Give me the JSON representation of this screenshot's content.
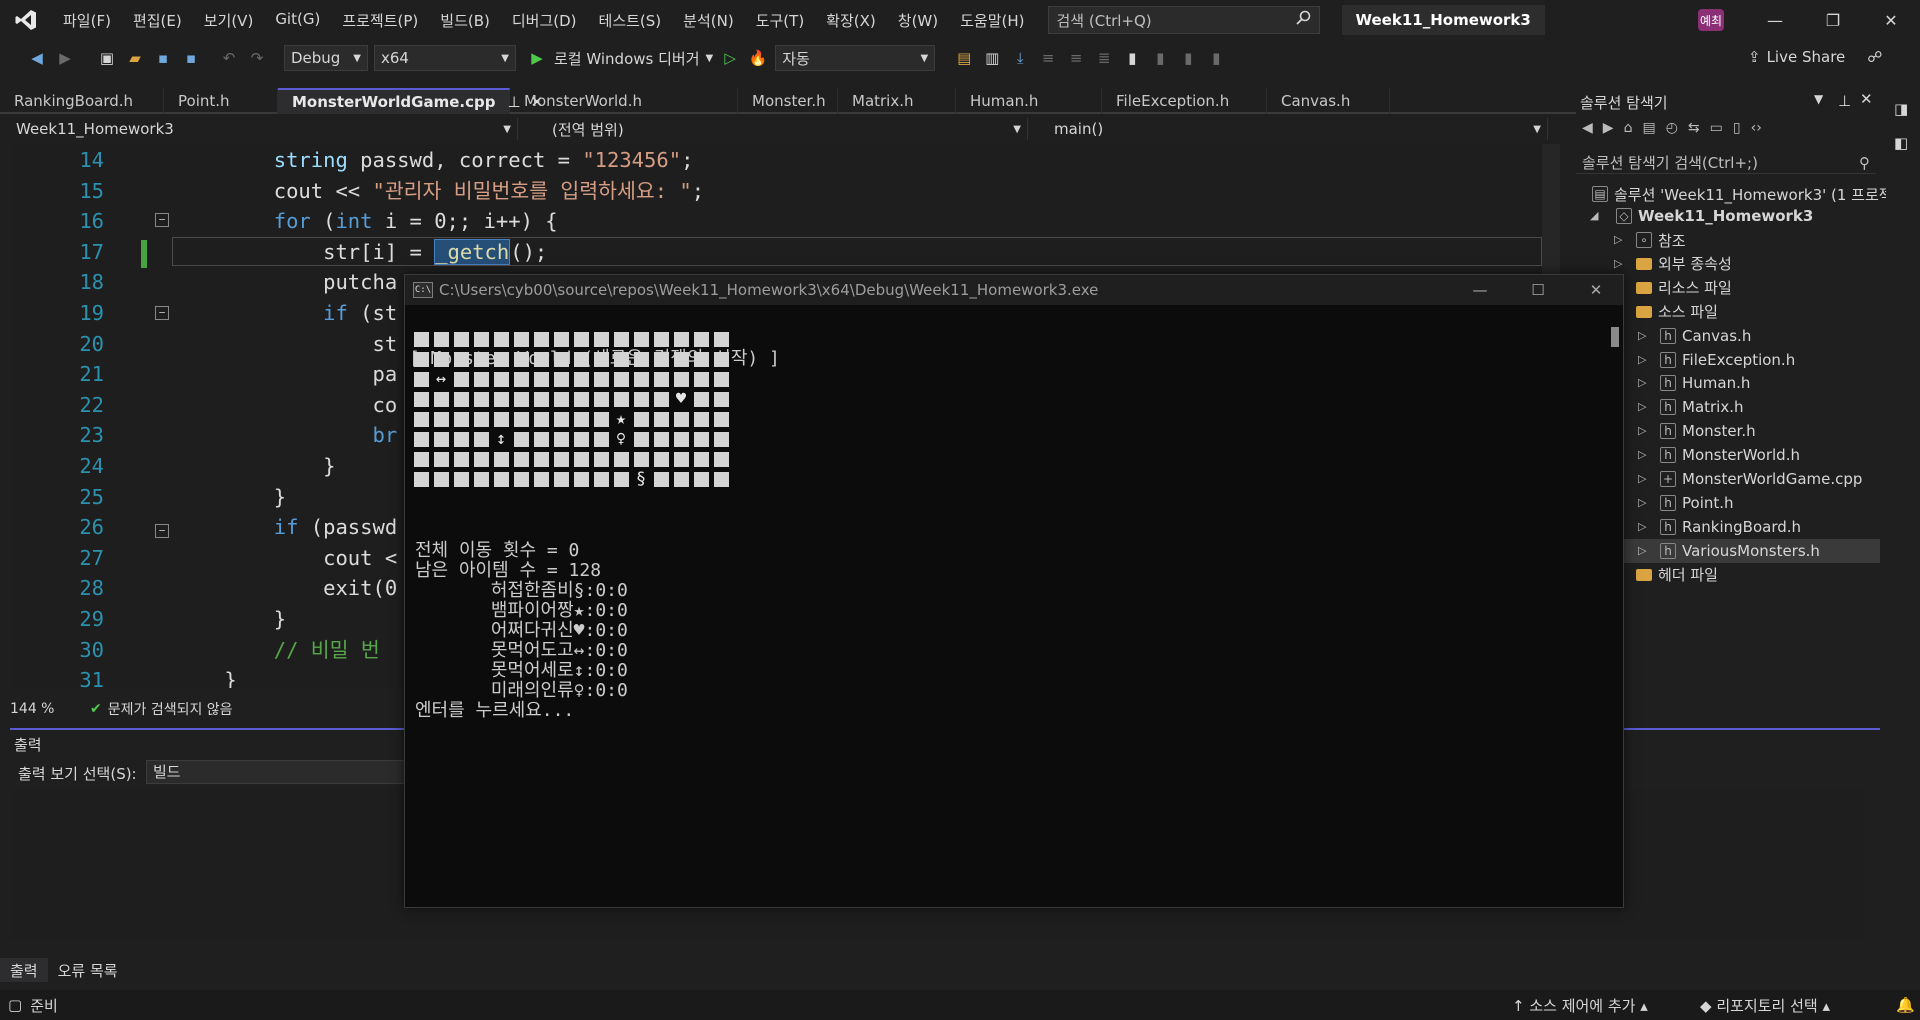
{
  "menubar": {
    "items": [
      "파일(F)",
      "편집(E)",
      "보기(V)",
      "Git(G)",
      "프로젝트(P)",
      "빌드(B)",
      "디버그(D)",
      "테스트(S)",
      "분석(N)",
      "도구(T)",
      "확장(X)",
      "창(W)",
      "도움말(H)"
    ],
    "search_placeholder": "검색 (Ctrl+Q)",
    "solution_name": "Week11_Homework3",
    "avatar_initials": "예최"
  },
  "toolbar": {
    "config": "Debug",
    "platform": "x64",
    "run_label": "로컬 Windows 디버거",
    "mode": "자동",
    "live_share": "Live Share"
  },
  "tabs": [
    {
      "label": "RankingBoard.h",
      "active": false
    },
    {
      "label": "Point.h",
      "active": false
    },
    {
      "label": "MonsterWorldGame.cpp",
      "active": true
    },
    {
      "label": "MonsterWorld.h",
      "active": false
    },
    {
      "label": "Monster.h",
      "active": false
    },
    {
      "label": "Matrix.h",
      "active": false
    },
    {
      "label": "Human.h",
      "active": false
    },
    {
      "label": "FileException.h",
      "active": false
    },
    {
      "label": "Canvas.h",
      "active": false
    }
  ],
  "navbar": {
    "project": "Week11_Homework3",
    "scope": "(전역 범위)",
    "member": "main()"
  },
  "code": {
    "lines": [
      {
        "n": "14",
        "html": "        <span class=\"var\">string</span> passwd, correct = <span class=\"str\">\"123456\"</span>;"
      },
      {
        "n": "15",
        "html": "        cout &lt;&lt; <span class=\"str\">\"관리자 비밀번호를 입력하세요: \"</span>;"
      },
      {
        "n": "16",
        "html": "        <span class=\"kw\">for</span> (<span class=\"kw\">int</span> i = 0;; i++) {"
      },
      {
        "n": "17",
        "html": "            str[i] = <span class=\"hl fn\">_getch</span>();"
      },
      {
        "n": "18",
        "html": "            putcha"
      },
      {
        "n": "19",
        "html": "            <span class=\"kw\">if</span> (st"
      },
      {
        "n": "20",
        "html": "                st"
      },
      {
        "n": "21",
        "html": "                pa"
      },
      {
        "n": "22",
        "html": "                co"
      },
      {
        "n": "23",
        "html": "                <span class=\"kw\">br</span>"
      },
      {
        "n": "24",
        "html": "            }"
      },
      {
        "n": "25",
        "html": "        }"
      },
      {
        "n": "26",
        "html": "        <span class=\"kw\">if</span> (passwd"
      },
      {
        "n": "27",
        "html": "            cout &lt;"
      },
      {
        "n": "28",
        "html": "            exit(0"
      },
      {
        "n": "29",
        "html": "        }"
      },
      {
        "n": "30",
        "html": "        <span class=\"cm\">// 비밀 번</span>"
      },
      {
        "n": "31",
        "html": "    }"
      }
    ]
  },
  "editor_status": {
    "zoom": "144 %",
    "issues": "문제가 검색되지 않음"
  },
  "output": {
    "title": "출력",
    "select_label": "출력 보기 선택(S):",
    "select_value": "빌드"
  },
  "bottom_tabs": [
    "출력",
    "오류 목록"
  ],
  "statusbar": {
    "ready": "준비",
    "source_control": "소스 제어에 추가",
    "repo": "리포지토리 선택"
  },
  "solution_explorer": {
    "title": "솔루션 탐색기",
    "search": "솔루션 탐색기 검색(Ctrl+;)",
    "solution": "솔루션 'Week11_Homework3' (1 프로젝",
    "project": "Week11_Homework3",
    "nodes": [
      {
        "label": "참조",
        "level": 2,
        "kind": "ref"
      },
      {
        "label": "외부 종속성",
        "level": 2,
        "kind": "folder"
      },
      {
        "label": "리소스 파일",
        "level": 2,
        "kind": "folder"
      },
      {
        "label": "소스 파일",
        "level": 2,
        "kind": "folder"
      },
      {
        "label": "Canvas.h",
        "level": 3,
        "kind": "file"
      },
      {
        "label": "FileException.h",
        "level": 3,
        "kind": "file"
      },
      {
        "label": "Human.h",
        "level": 3,
        "kind": "file"
      },
      {
        "label": "Matrix.h",
        "level": 3,
        "kind": "file"
      },
      {
        "label": "Monster.h",
        "level": 3,
        "kind": "file"
      },
      {
        "label": "MonsterWorld.h",
        "level": 3,
        "kind": "file"
      },
      {
        "label": "MonsterWorldGame.cpp",
        "level": 3,
        "kind": "cpp"
      },
      {
        "label": "Point.h",
        "level": 3,
        "kind": "file"
      },
      {
        "label": "RankingBoard.h",
        "level": 3,
        "kind": "file"
      },
      {
        "label": "VariousMonsters.h",
        "level": 3,
        "kind": "file",
        "selected": true
      },
      {
        "label": "헤더 파일",
        "level": 2,
        "kind": "folder"
      }
    ]
  },
  "console": {
    "path": "C:\\Users\\cyb00\\source\\repos\\Week11_Homework3\\x64\\Debug\\Week11_Homework3.exe",
    "header": "[ Monster World (새로운 경쟁의 시작) ]",
    "grid": [
      "################",
      "################",
      "#↔##############",
      "#############♥##",
      "##########★#####",
      "####↕#####♀#####",
      "################",
      "###########§####"
    ],
    "lines": [
      "전체 이동 횟수 = 0",
      "남은 아이템 수 = 128",
      "       허접한좀비§:0:0",
      "       뱀파이어짱★:0:0",
      "       어쩌다귀신♥:0:0",
      "       못먹어도고↔:0:0",
      "       못먹어세로↕:0:0",
      "       미래의인류♀:0:0",
      "엔터를 누르세요..."
    ]
  }
}
